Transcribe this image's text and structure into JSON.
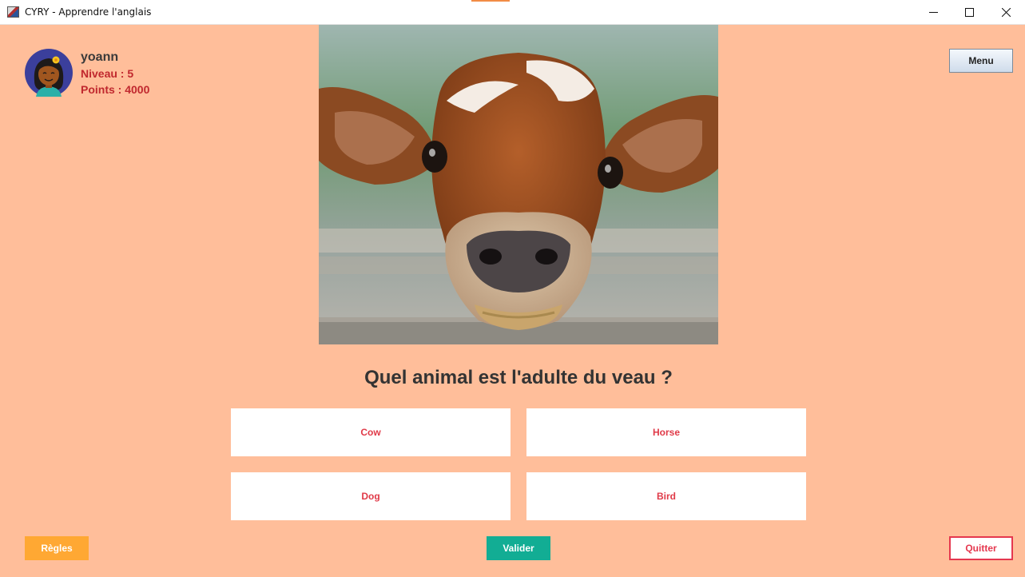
{
  "window": {
    "title": "CYRY - Apprendre l'anglais",
    "icons": [
      "app-icon",
      "minimize-icon",
      "maximize-icon",
      "close-icon"
    ]
  },
  "user": {
    "name": "yoann",
    "level": "Niveau : 5",
    "points": "Points : 4000",
    "avatar_icon": "avatar-girl-icon"
  },
  "header": {
    "menu_label": "Menu"
  },
  "quiz": {
    "image": "calf-photo",
    "question": "Quel animal est l'adulte du veau ?",
    "answers": [
      "Cow",
      "Horse",
      "Dog",
      "Bird"
    ]
  },
  "footer": {
    "rules_label": "Règles",
    "validate_label": "Valider",
    "quit_label": "Quitter"
  },
  "colors": {
    "background": "#ffbe9a",
    "answer_text": "#e03a48",
    "stats_text": "#c0282e",
    "rules_button": "#ffa833",
    "validate_button": "#12ad94",
    "quit_border": "#e5384f"
  }
}
